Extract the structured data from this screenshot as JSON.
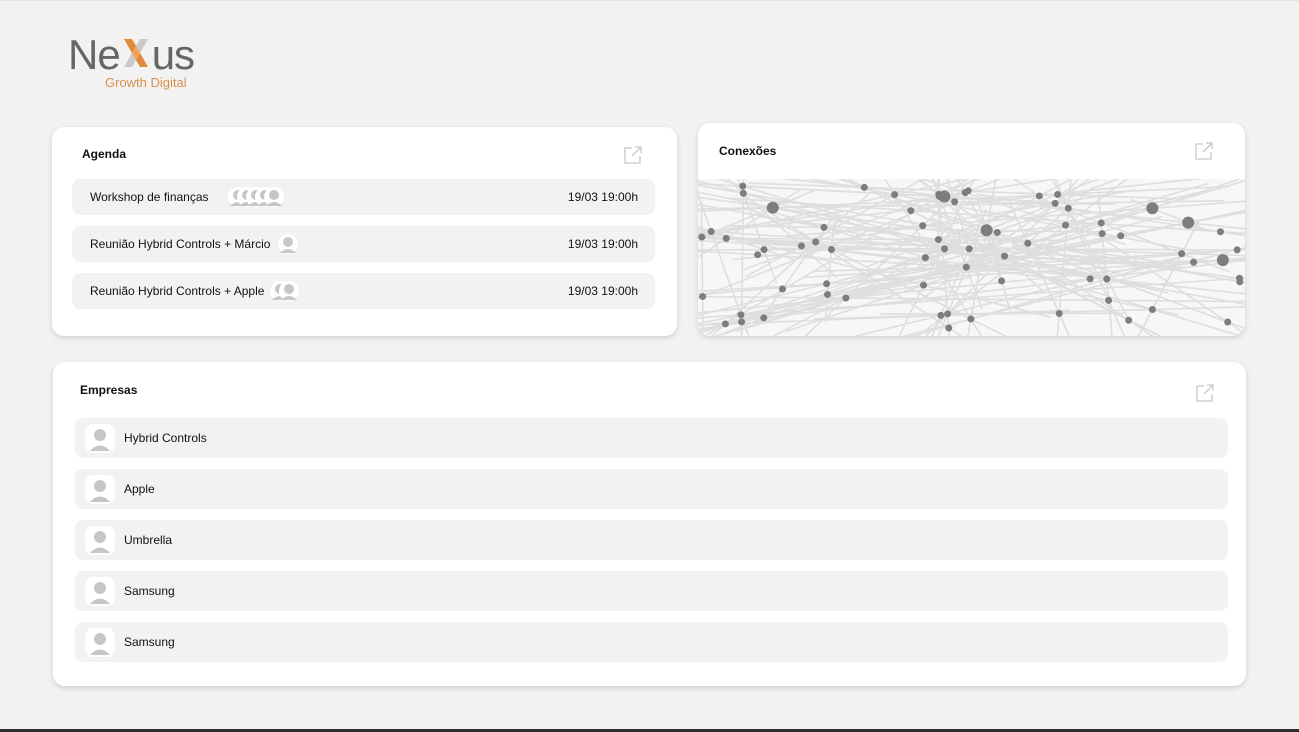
{
  "brand": {
    "logo_left": "Ne",
    "logo_right": "us",
    "tagline": "Growth Digital",
    "accent_color": "#e08a3c"
  },
  "agenda": {
    "title": "Agenda",
    "open_icon": "external-link-icon",
    "events": [
      {
        "name": "Workshop de finanças",
        "datetime": "19/03 19:00h",
        "participants": 5
      },
      {
        "name": "Reunião Hybrid Controls + Márcio",
        "datetime": "19/03 19:00h",
        "participants": 1
      },
      {
        "name": "Reunião Hybrid Controls + Apple",
        "datetime": "19/03 19:00h",
        "participants": 2
      }
    ]
  },
  "connections": {
    "title": "Conexões",
    "open_icon": "external-link-icon",
    "image": "network-graph"
  },
  "companies": {
    "title": "Empresas",
    "open_icon": "external-link-icon",
    "items": [
      {
        "name": "Hybrid Controls",
        "icon": "user-avatar-icon"
      },
      {
        "name": "Apple",
        "icon": "user-avatar-icon"
      },
      {
        "name": "Umbrella",
        "icon": "user-avatar-icon"
      },
      {
        "name": "Samsung",
        "icon": "user-avatar-icon"
      },
      {
        "name": "Samsung",
        "icon": "user-avatar-icon"
      }
    ]
  }
}
